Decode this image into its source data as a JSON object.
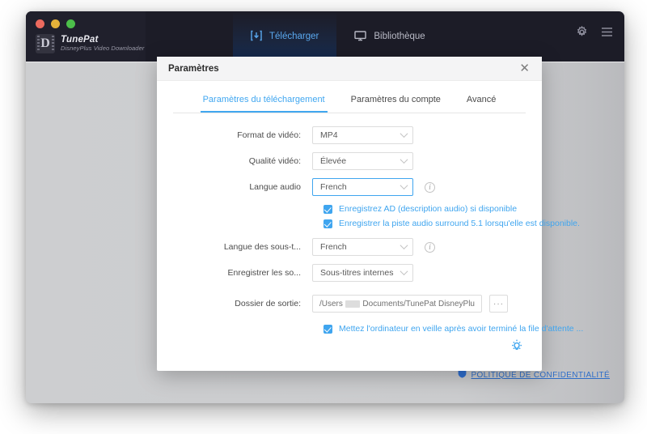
{
  "app": {
    "brand_name": "TunePat",
    "brand_subtitle": "DisneyPlus Video Downloader",
    "nav_tabs": [
      {
        "label": "Télécharger",
        "icon": "download-icon",
        "active": true
      },
      {
        "label": "Bibliothèque",
        "icon": "monitor-icon",
        "active": false
      }
    ],
    "titlebar_icons": [
      "gear-icon",
      "hamburger-menu-icon"
    ],
    "traffic_lights": [
      "close",
      "minimize",
      "maximize"
    ],
    "accent_color": "#41a7f0",
    "titlebar_color": "#1c1c27",
    "body_color": "#cbccce"
  },
  "footer": {
    "privacy_link": "POLITIQUE DE CONFIDENTIALITÉ",
    "privacy_icon": "shield-icon"
  },
  "dialog": {
    "title": "Paramètres",
    "close_label": "✕",
    "tabs": [
      {
        "label": "Paramètres du téléchargement",
        "active": true
      },
      {
        "label": "Paramètres du compte",
        "active": false
      },
      {
        "label": "Avancé",
        "active": false
      }
    ],
    "fields": [
      {
        "label": "Format de vidéo:",
        "value": "MP4",
        "focused": false,
        "info": false
      },
      {
        "label": "Qualité vidéo:",
        "value": "Élevée",
        "focused": false,
        "info": false
      },
      {
        "label": "Langue audio",
        "value": "French",
        "focused": true,
        "info": true
      },
      {
        "label": "Langue des sous-t...",
        "value": "French",
        "focused": false,
        "info": true
      },
      {
        "label": "Enregistrer les so...",
        "value": "Sous-titres internes",
        "focused": false,
        "info": false
      }
    ],
    "audio_checkboxes": [
      {
        "label": "Enregistrez AD (description audio) si disponible",
        "checked": true
      },
      {
        "label": "Enregistrer la piste audio surround 5.1 lorsqu'elle est disponible.",
        "checked": true
      }
    ],
    "output_folder": {
      "label": "Dossier de sortie:",
      "value_prefix": "/Users",
      "value_suffix": "Documents/TunePat DisneyPlu",
      "browse_label": "···"
    },
    "sleep_checkbox": {
      "label": "Mettez l'ordinateur en veille après avoir terminé la file d'attente ...",
      "checked": true
    },
    "bulb_icon": "lightbulb-icon"
  }
}
